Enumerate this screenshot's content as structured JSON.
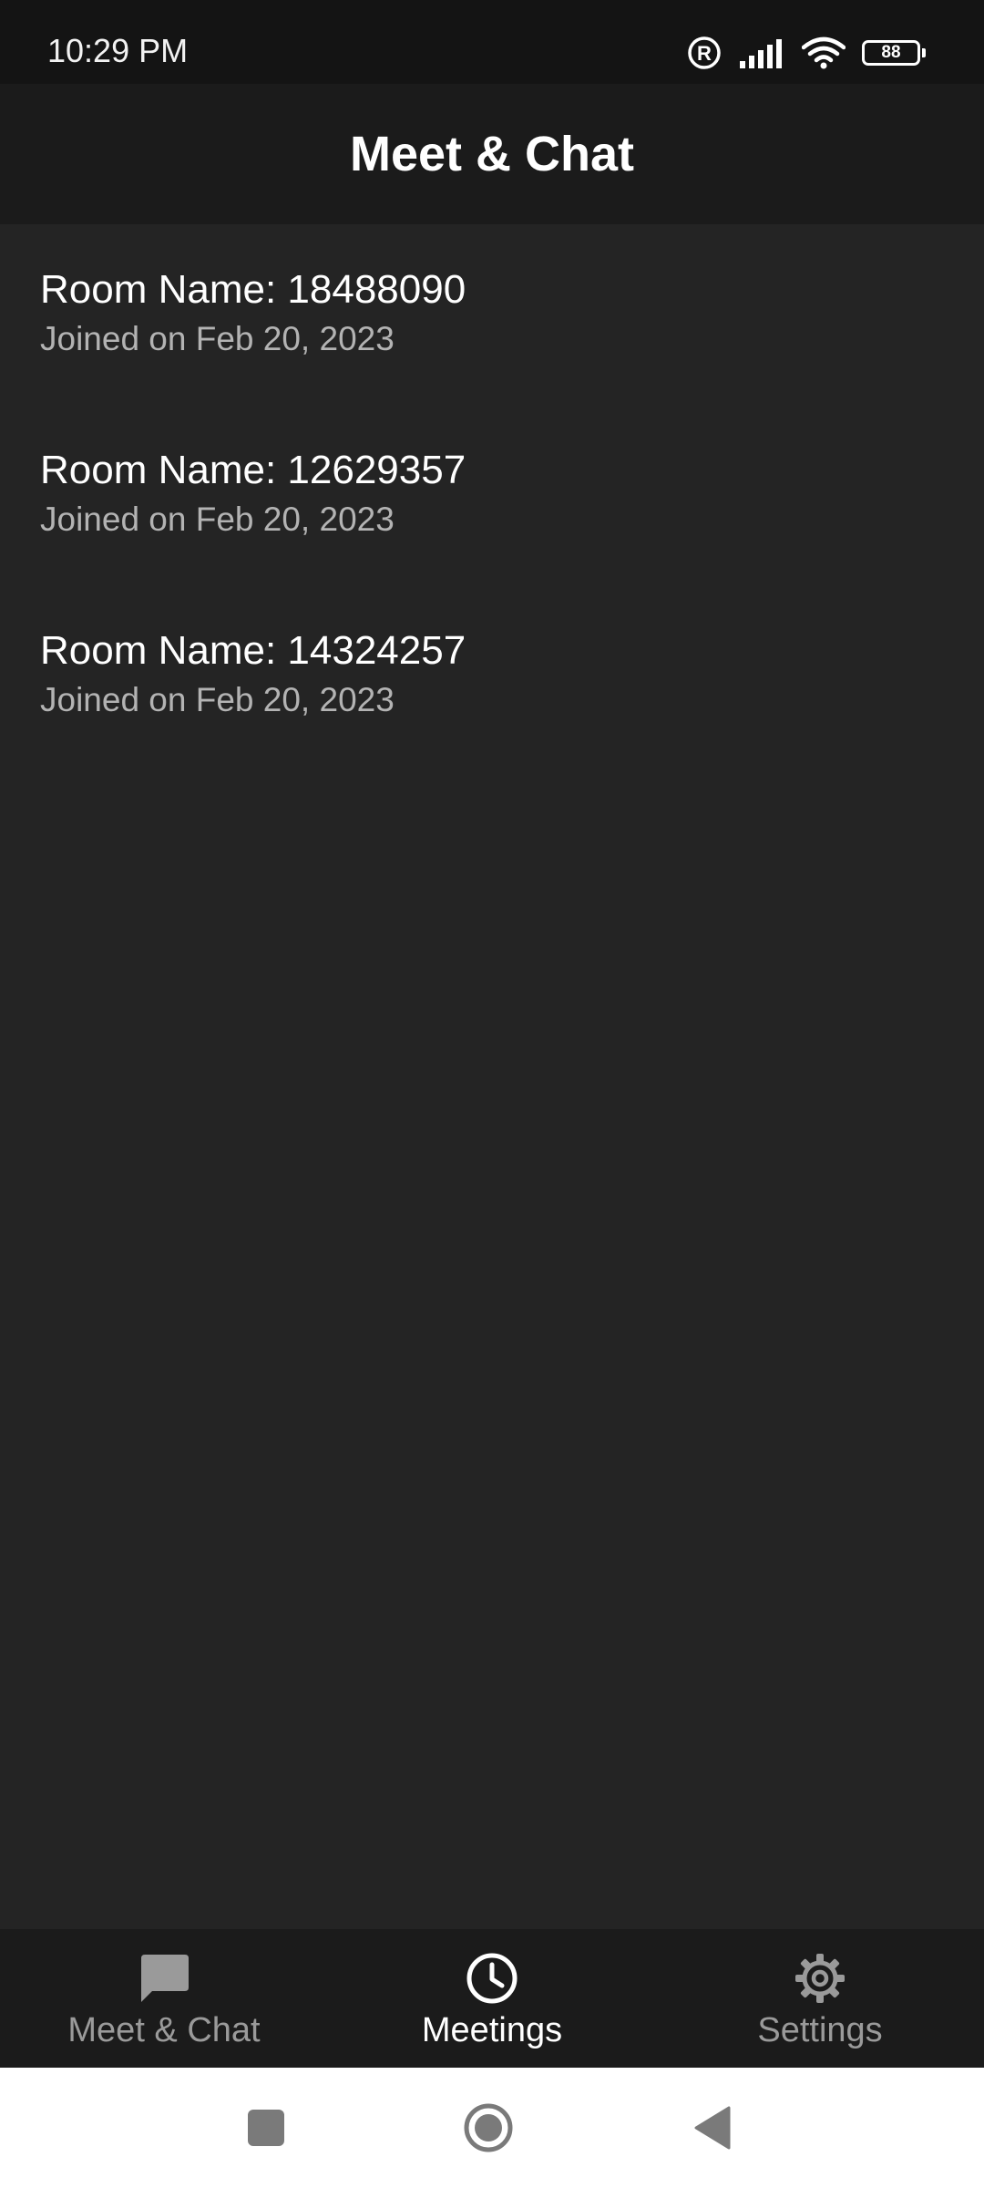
{
  "status_bar": {
    "time": "10:29 PM",
    "battery_level": "88",
    "icons": [
      "registered-icon",
      "signal-icon",
      "wifi-icon",
      "battery-icon"
    ]
  },
  "header": {
    "title": "Meet & Chat"
  },
  "rooms": [
    {
      "name": "Room Name: 18488090",
      "joined": "Joined on Feb 20, 2023"
    },
    {
      "name": "Room Name: 12629357",
      "joined": "Joined on Feb 20, 2023"
    },
    {
      "name": "Room Name: 14324257",
      "joined": "Joined on Feb 20, 2023"
    }
  ],
  "bottom_nav": {
    "active_tab": "Meetings",
    "items": [
      {
        "label": "Meet & Chat",
        "icon": "chat-bubble-icon"
      },
      {
        "label": "Meetings",
        "icon": "clock-icon"
      },
      {
        "label": "Settings",
        "icon": "gear-icon"
      }
    ]
  },
  "system_nav": {
    "buttons": [
      "recents-icon",
      "home-icon",
      "back-icon"
    ]
  },
  "colors": {
    "background": "#242424",
    "header_bg": "#1b1b1b",
    "status_bar_bg": "#141414",
    "primary_text": "#ffffff",
    "secondary_text": "#b3b3b3",
    "inactive_nav": "#9a9a9a"
  }
}
